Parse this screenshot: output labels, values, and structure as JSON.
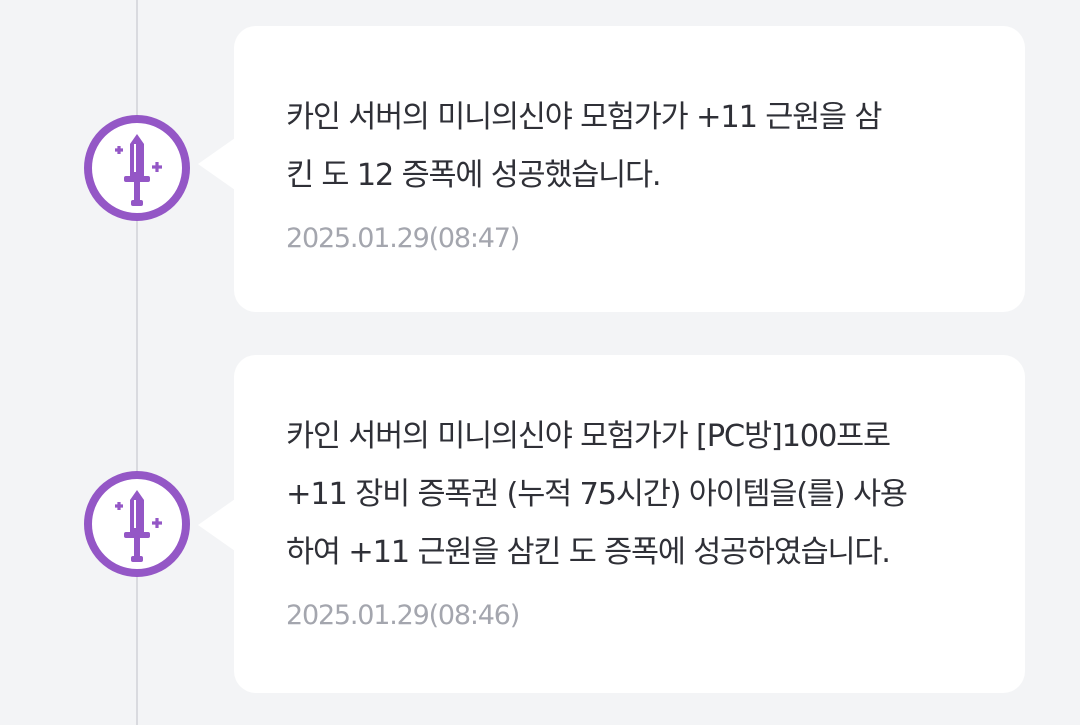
{
  "colors": {
    "page_background": "#f3f4f6",
    "card_background": "#ffffff",
    "timeline_line": "#d9dadf",
    "icon_accent": "#9457c6",
    "message_text": "#2f3037",
    "timestamp_text": "#a4a6ae"
  },
  "entries": [
    {
      "icon": "sword-icon",
      "message": "카인 서버의 미니의신야 모험가가 +11 근원을 삼\n킨 도 12 증폭에 성공했습니다.",
      "timestamp": "2025.01.29(08:47)"
    },
    {
      "icon": "sword-icon",
      "message": "카인 서버의 미니의신야 모험가가 [PC방]100프로\n+11 장비 증폭권 (누적 75시간) 아이템을(를) 사용\n하여 +11 근원을 삼킨 도 증폭에 성공하였습니다.",
      "timestamp": "2025.01.29(08:46)"
    }
  ]
}
